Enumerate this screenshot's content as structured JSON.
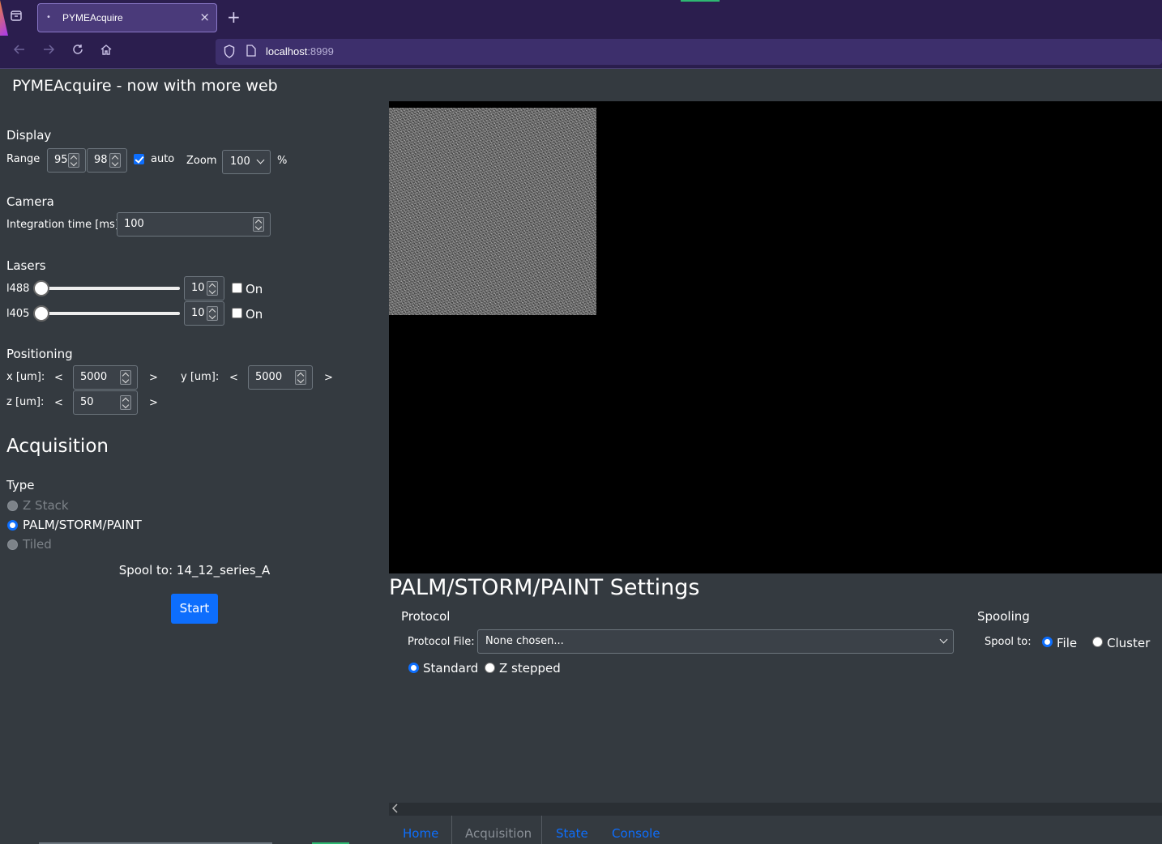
{
  "browser": {
    "tab_title": "PYMEAcquire",
    "url_host": "localhost",
    "url_port": ":8999",
    "new_tab": "+",
    "close": "×"
  },
  "app": {
    "title": "PYMEAcquire - now with more web"
  },
  "display": {
    "heading": "Display",
    "range_label": "Range",
    "range_min": "95",
    "range_max": "98",
    "auto_label": "auto",
    "auto_checked": true,
    "zoom_label": "Zoom",
    "zoom_value": "100",
    "zoom_unit": "%"
  },
  "camera": {
    "heading": "Camera",
    "integration_label": "Integration time [ms]:",
    "integration_value": "100"
  },
  "lasers": {
    "heading": "Lasers",
    "items": [
      {
        "name": "l488",
        "value": "10",
        "on_label": "On",
        "on": false,
        "slider_fraction": 0.0
      },
      {
        "name": "l405",
        "value": "10",
        "on_label": "On",
        "on": false,
        "slider_fraction": 0.0
      }
    ]
  },
  "positioning": {
    "heading": "Positioning",
    "x_label": "x [um]:",
    "x_value": "5000",
    "y_label": "y [um]:",
    "y_value": "5000",
    "z_label": "z [um]:",
    "z_value": "50",
    "dec": "<",
    "inc": ">"
  },
  "acquisition": {
    "heading": "Acquisition",
    "type_label": "Type",
    "types": [
      {
        "label": "Z Stack",
        "state": "disabled"
      },
      {
        "label": "PALM/STORM/PAINT",
        "state": "selected"
      },
      {
        "label": "Tiled",
        "state": "disabled"
      }
    ],
    "spool_to": "Spool to: 14_12_series_A",
    "start_label": "Start"
  },
  "settings": {
    "heading": "PALM/STORM/PAINT Settings",
    "protocol_heading": "Protocol",
    "protocol_file_label": "Protocol File:",
    "protocol_file_value": "None chosen...",
    "mode_standard": "Standard",
    "mode_zstepped": "Z stepped",
    "spooling_heading": "Spooling",
    "spool_to_label": "Spool to:",
    "spool_file": "File",
    "spool_cluster": "Cluster"
  },
  "nav": {
    "tabs": [
      "Home",
      "Acquisition",
      "State",
      "Console"
    ],
    "active": "Acquisition"
  },
  "colors": {
    "accent": "#0d6efd",
    "panel_bg": "#343a40",
    "browser_bg": "#2b1e4e"
  }
}
